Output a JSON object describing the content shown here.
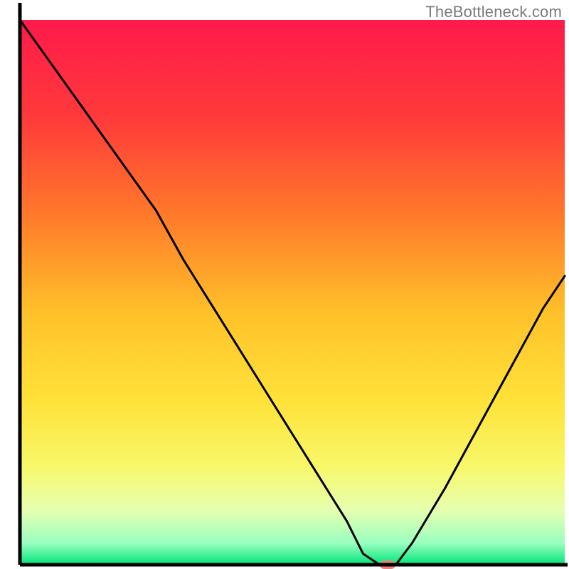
{
  "watermark": "TheBottleneck.com",
  "chart_data": {
    "type": "line",
    "title": "",
    "xlabel": "",
    "ylabel": "",
    "xlim": [
      0,
      100
    ],
    "ylim": [
      0,
      100
    ],
    "x": [
      0,
      5,
      10,
      15,
      20,
      25,
      30,
      35,
      40,
      45,
      50,
      55,
      60,
      63,
      66,
      69,
      72,
      78,
      84,
      90,
      96,
      100
    ],
    "values": [
      100,
      93,
      86,
      79,
      72,
      65,
      56,
      48,
      40,
      32,
      24,
      16,
      8,
      2,
      0,
      0,
      4,
      14,
      25,
      36,
      47,
      53
    ],
    "marker": {
      "x": 67.5,
      "y": 0
    },
    "background_gradient": {
      "stops": [
        {
          "offset": 0.0,
          "color": "#ff1a4b"
        },
        {
          "offset": 0.18,
          "color": "#ff3a3a"
        },
        {
          "offset": 0.36,
          "color": "#ff7a2a"
        },
        {
          "offset": 0.54,
          "color": "#ffc22a"
        },
        {
          "offset": 0.7,
          "color": "#ffe23a"
        },
        {
          "offset": 0.82,
          "color": "#f8f86a"
        },
        {
          "offset": 0.9,
          "color": "#e6ffb0"
        },
        {
          "offset": 0.96,
          "color": "#9affc0"
        },
        {
          "offset": 1.0,
          "color": "#00e57a"
        }
      ]
    },
    "border_color": "#000000",
    "line_color": "#000000",
    "marker_color": "#e8847a"
  }
}
